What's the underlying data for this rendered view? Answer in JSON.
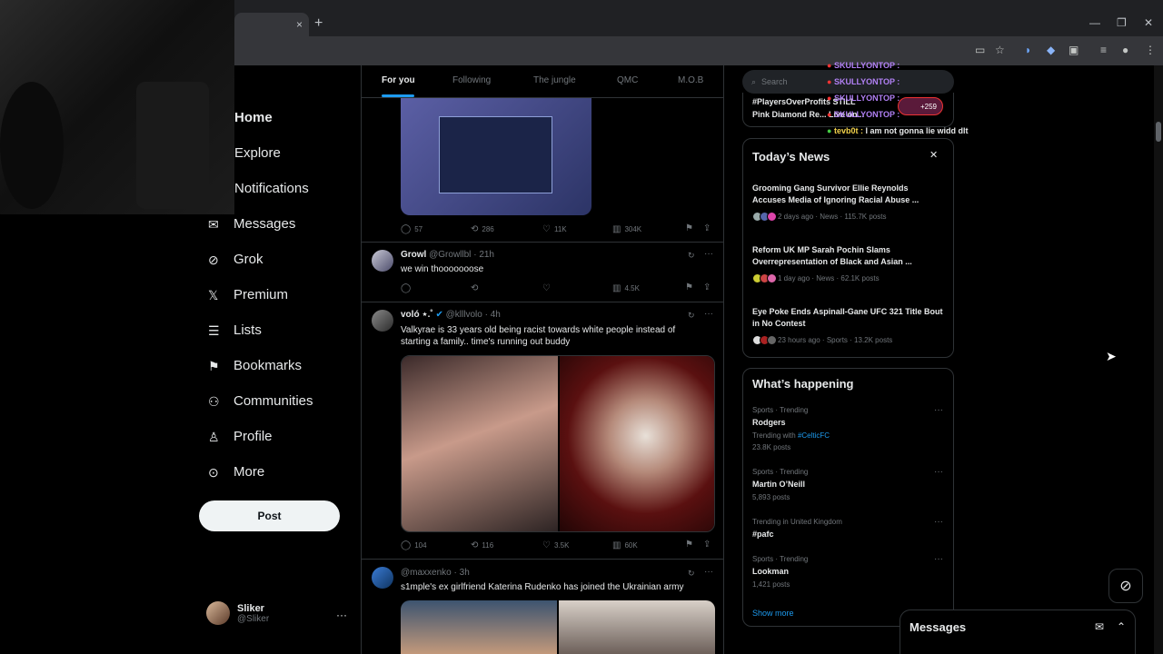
{
  "browser": {
    "tab_close": "×",
    "new_tab": "+",
    "window_controls": [
      "—",
      "❐",
      "✕"
    ]
  },
  "nav": {
    "items": [
      {
        "label": "Home",
        "icon": "home-icon"
      },
      {
        "label": "Explore",
        "icon": "search-icon"
      },
      {
        "label": "Notifications",
        "icon": "bell-icon"
      },
      {
        "label": "Messages",
        "icon": "envelope-icon"
      },
      {
        "label": "Grok",
        "icon": "grok-icon"
      },
      {
        "label": "Premium",
        "icon": "x-logo-icon"
      },
      {
        "label": "Lists",
        "icon": "list-icon"
      },
      {
        "label": "Bookmarks",
        "icon": "bookmark-icon"
      },
      {
        "label": "Communities",
        "icon": "people-icon"
      },
      {
        "label": "Profile",
        "icon": "person-icon"
      },
      {
        "label": "More",
        "icon": "more-circle-icon"
      }
    ],
    "post_label": "Post"
  },
  "profile": {
    "name": "Sliker",
    "handle": "@Sliker",
    "more": "···"
  },
  "feed": {
    "tabs": [
      {
        "label": "For you",
        "active": true
      },
      {
        "label": "Following",
        "active": false
      },
      {
        "label": "The jungle",
        "active": false
      },
      {
        "label": "QMC",
        "active": false
      },
      {
        "label": "M.O.B",
        "active": false
      }
    ],
    "tweets": [
      {
        "stats": {
          "replies": "57",
          "reposts": "286",
          "likes": "11K",
          "views": "304K"
        }
      },
      {
        "name": "Growl",
        "handle": "@Growllbl",
        "time": "21h",
        "text": "we win thooooooose",
        "stats": {
          "replies": "",
          "reposts": "",
          "likes": "",
          "views": "4.5K"
        }
      },
      {
        "name": "voló ⋆.˚",
        "handle": "@klllvolo",
        "time": "4h",
        "text": "Valkyrae is 33 years old being racist towards white people instead of starting a family.. time's running out buddy",
        "stats": {
          "replies": "104",
          "reposts": "116",
          "likes": "3.5K",
          "views": "60K"
        }
      },
      {
        "name": "",
        "handle": "@maxxenko",
        "time": "3h",
        "text": "s1mple's ex girlfriend Katerina Rudenko has joined the Ukrainian army"
      }
    ]
  },
  "sidebar": {
    "search_placeholder": "Search",
    "trend_top": {
      "line1": "#PlayersOverProfits STILL",
      "line2": "Pink Diamond Re... Live on..."
    },
    "news": {
      "title": "Today’s News",
      "close": "✕",
      "items": [
        {
          "headline": "Grooming Gang Survivor Ellie Reynolds Accuses Media of Ignoring Racial Abuse ...",
          "meta": "2 days ago · News · 115.7K posts"
        },
        {
          "headline": "Reform UK MP Sarah Pochin Slams Overrepresentation of Black and Asian ...",
          "meta": "1 day ago · News · 62.1K posts"
        },
        {
          "headline": "Eye Poke Ends Aspinall-Gane UFC 321 Title Bout in No Contest",
          "meta": "23 hours ago · Sports · 13.2K posts"
        }
      ]
    },
    "happening": {
      "title": "What’s happening",
      "items": [
        {
          "context": "Sports · Trending",
          "name": "Rodgers",
          "extra_prefix": "Trending with ",
          "extra_link": "#CelticFC",
          "posts": "23.8K posts"
        },
        {
          "context": "Sports · Trending",
          "name": "Martin O’Neill",
          "posts": "5,893 posts"
        },
        {
          "context": "Trending in United Kingdom",
          "name": "#pafc",
          "posts": ""
        },
        {
          "context": "Sports · Trending",
          "name": "Lookman",
          "posts": "1,421 posts"
        }
      ],
      "show_more": "Show more"
    }
  },
  "chat_overlay": {
    "lines": [
      {
        "user": "SKULLYONTOP :",
        "msg": ""
      },
      {
        "user": "SKULLYONTOP :",
        "msg": ""
      },
      {
        "user": "SKULLYONTOP :",
        "msg": ""
      },
      {
        "user": "SKULLYONTOP :",
        "msg": ""
      },
      {
        "user": "tevb0t :",
        "msg": "I am not gonna lie widd dlt"
      }
    ],
    "badge": "+259"
  },
  "messages_drawer": {
    "title": "Messages"
  },
  "colors": {
    "accent": "#1d9bf0",
    "background": "#000000",
    "border": "#2f3336",
    "muted": "#71767b"
  }
}
